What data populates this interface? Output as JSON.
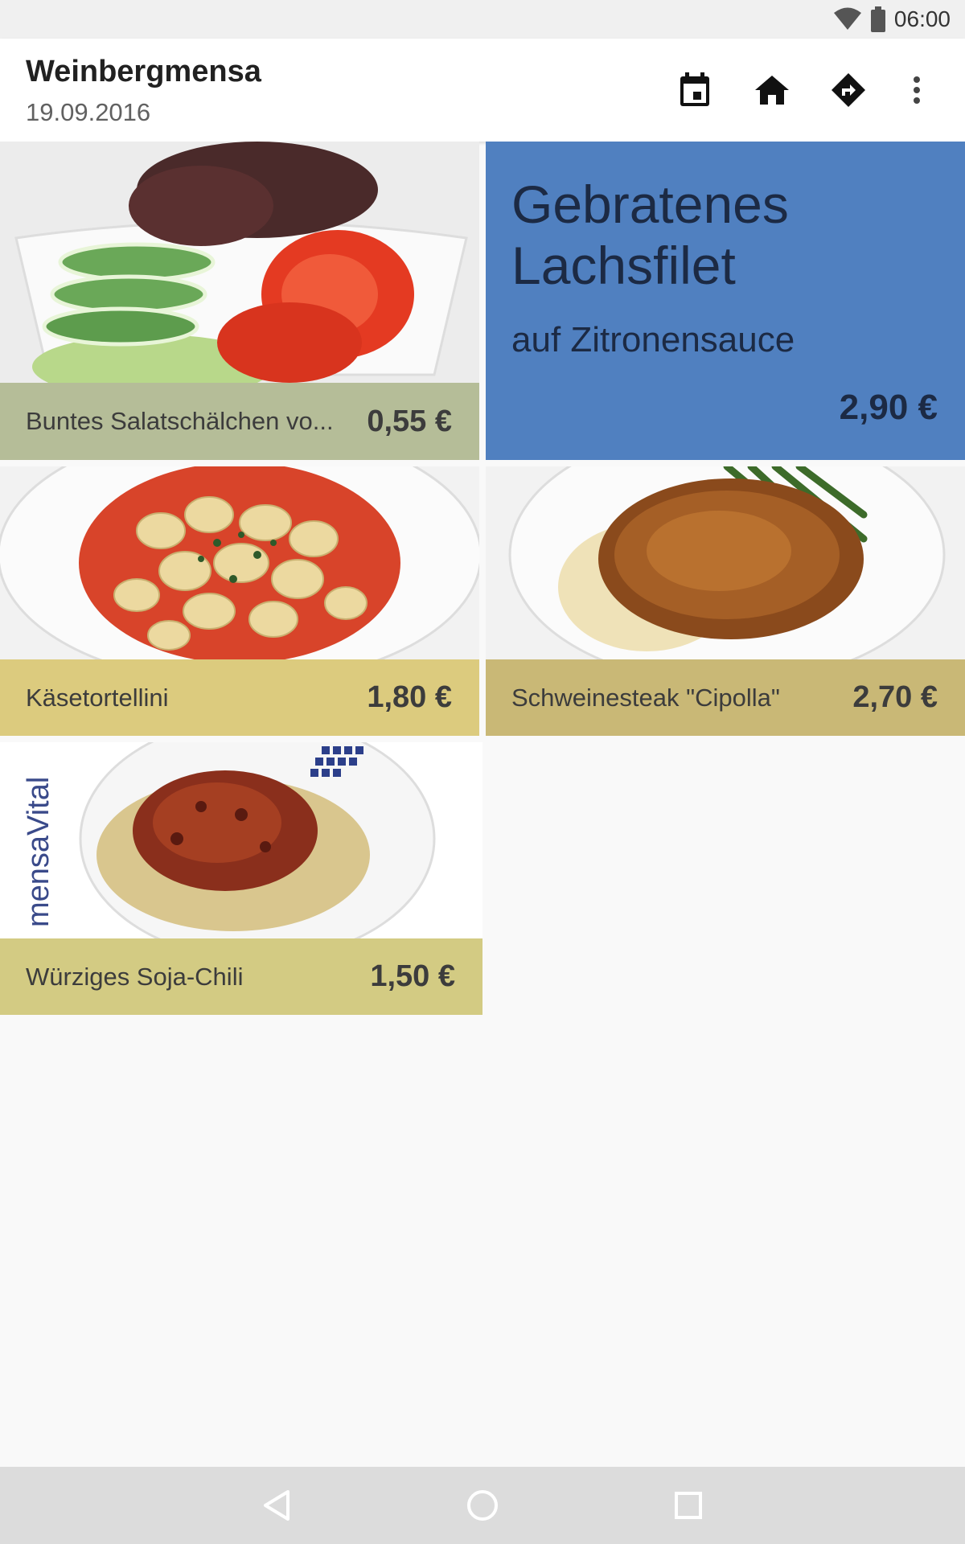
{
  "status_bar": {
    "time": "06:00",
    "icons": [
      "wifi-icon",
      "battery-icon"
    ]
  },
  "app_bar": {
    "title": "Weinbergmensa",
    "date": "19.09.2016",
    "actions": [
      "calendar-icon",
      "home-icon",
      "directions-icon",
      "more-vert-icon"
    ]
  },
  "menu": [
    {
      "name": "Buntes Salatschälchen vo...",
      "price": "0,55 €",
      "bg": "#b5bd98"
    },
    {
      "name": "Gebratenes Lachsfilet",
      "description": "auf Zitronensauce",
      "price": "2,90 €",
      "bg": "#5080c0"
    },
    {
      "name": "Käsetortellini",
      "price": "1,80 €",
      "bg": "#dccb7e"
    },
    {
      "name": "Schweinesteak \"Cipolla\"",
      "price": "2,70 €",
      "bg": "#c9b876"
    },
    {
      "name": "Würziges Soja-Chili",
      "price": "1,50 €",
      "bg": "#d3cb83",
      "logo_text": "mensaVital"
    }
  ],
  "nav_bar": {
    "buttons": [
      "back-icon",
      "home-circle-icon",
      "recents-icon"
    ]
  }
}
